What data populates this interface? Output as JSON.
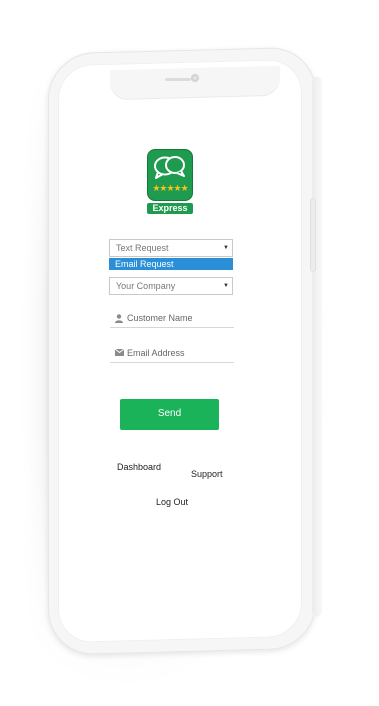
{
  "app": {
    "badge_label": "Express",
    "stars": "★★★★★"
  },
  "form": {
    "request_select_value": "Text Request",
    "request_option_highlighted": "Email Request",
    "company_select_value": "Your Company",
    "customer_name_placeholder": "Customer Name",
    "email_placeholder": "Email Address",
    "send_label": "Send"
  },
  "nav": {
    "dashboard": "Dashboard",
    "support": "Support",
    "logout": "Log Out"
  },
  "colors": {
    "brand_green": "#1f9b4f",
    "button_green": "#1bb35a",
    "highlight_blue": "#2a8fd6",
    "star_yellow": "#f4c21b"
  },
  "icons": {
    "app": "chat-bubbles-icon",
    "person": "person-icon",
    "mail": "mail-icon"
  }
}
